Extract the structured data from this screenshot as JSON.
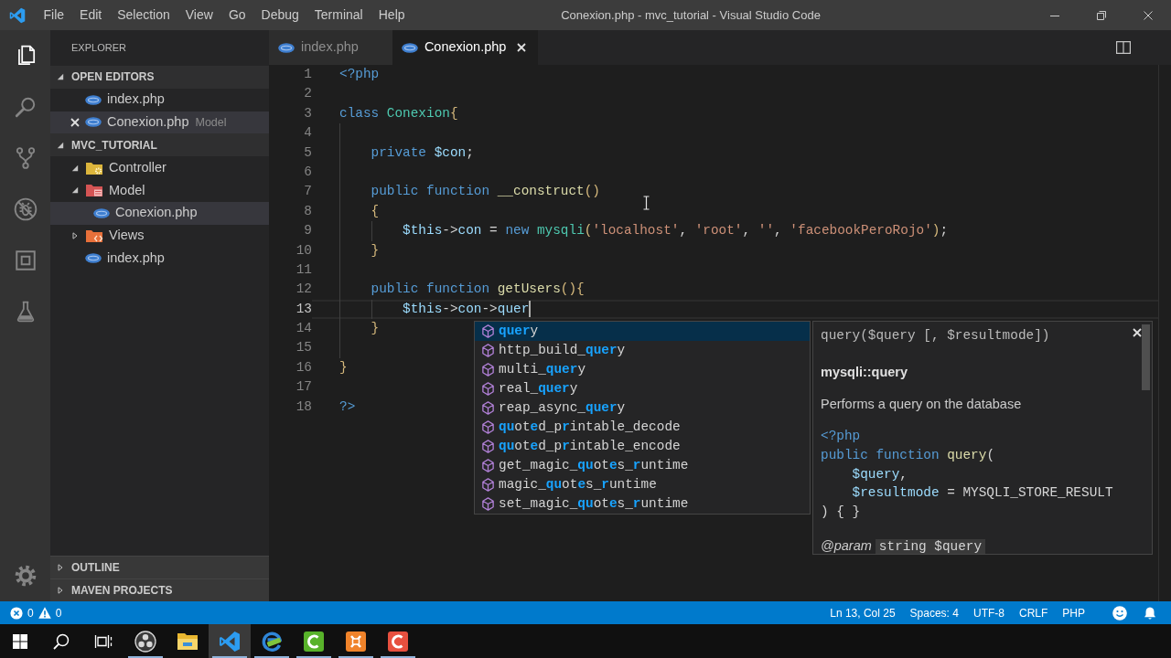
{
  "window": {
    "title": "Conexion.php - mvc_tutorial - Visual Studio Code"
  },
  "menu": [
    "File",
    "Edit",
    "Selection",
    "View",
    "Go",
    "Debug",
    "Terminal",
    "Help"
  ],
  "activity_bar": [
    {
      "kind": "explorer",
      "selected": true
    },
    {
      "kind": "search",
      "selected": false
    },
    {
      "kind": "source-control",
      "selected": false
    },
    {
      "kind": "debug",
      "selected": false
    },
    {
      "kind": "extensions",
      "selected": false
    },
    {
      "kind": "testing",
      "selected": false
    }
  ],
  "sidebar": {
    "title": "EXPLORER",
    "open_editors": {
      "title": "OPEN EDITORS",
      "expanded": true,
      "items": [
        {
          "name": "index.php",
          "selected": false
        },
        {
          "name": "Conexion.php",
          "description": "Model",
          "selected": true
        }
      ]
    },
    "folder": {
      "title": "MVC_TUTORIAL",
      "expanded": true,
      "children": [
        {
          "kind": "controller",
          "name": "Controller",
          "expanded": true,
          "selected": false
        },
        {
          "kind": "model",
          "name": "Model",
          "expanded": true,
          "selected": false,
          "children": [
            {
              "kind": "php",
              "name": "Conexion.php",
              "selected": true
            }
          ]
        },
        {
          "kind": "views",
          "name": "Views",
          "expanded": false,
          "selected": false
        },
        {
          "kind": "php",
          "name": "index.php",
          "selected": false
        }
      ]
    },
    "panels": [
      {
        "title": "OUTLINE",
        "expanded": false
      },
      {
        "title": "MAVEN PROJECTS",
        "expanded": false
      }
    ]
  },
  "editor": {
    "tabs": [
      {
        "label": "index.php",
        "selected": false
      },
      {
        "label": "Conexion.php",
        "selected": true
      }
    ],
    "lines": [
      {
        "number": "1",
        "current": false,
        "tokens": [
          {
            "kind": "keyword",
            "text": "<?php"
          }
        ]
      },
      {
        "number": "2",
        "current": false
      },
      {
        "number": "3",
        "current": false,
        "tokens": [
          {
            "kind": "keyword",
            "text": "class"
          },
          {
            "kind": "type",
            "text": " Conexion"
          },
          {
            "kind": "bracket",
            "text": "{"
          }
        ]
      },
      {
        "number": "4",
        "current": false
      },
      {
        "number": "5",
        "current": false,
        "tokens": [
          {
            "kind": "keyword",
            "text": "    private"
          },
          {
            "kind": "variable",
            "text": " $con"
          },
          {
            "kind": "plain",
            "text": ";"
          }
        ]
      },
      {
        "number": "6",
        "current": false
      },
      {
        "number": "7",
        "current": false,
        "tokens": [
          {
            "kind": "keyword",
            "text": "    public function"
          },
          {
            "kind": "function",
            "text": " __construct"
          },
          {
            "kind": "bracket",
            "text": "()"
          }
        ]
      },
      {
        "number": "8",
        "current": false,
        "tokens": [
          {
            "kind": "bracket",
            "text": "    {"
          }
        ]
      },
      {
        "number": "9",
        "current": false,
        "tokens": [
          {
            "kind": "variable",
            "text": "        $this"
          },
          {
            "kind": "plain",
            "text": "->"
          },
          {
            "kind": "variable",
            "text": "con"
          },
          {
            "kind": "plain",
            "text": " = "
          },
          {
            "kind": "keyword",
            "text": "new"
          },
          {
            "kind": "type",
            "text": " mysqli"
          },
          {
            "kind": "bracket",
            "text": "("
          },
          {
            "kind": "string",
            "text": "'localhost'"
          },
          {
            "kind": "plain",
            "text": ", "
          },
          {
            "kind": "string",
            "text": "'root'"
          },
          {
            "kind": "plain",
            "text": ", "
          },
          {
            "kind": "string",
            "text": "''"
          },
          {
            "kind": "plain",
            "text": ", "
          },
          {
            "kind": "string",
            "text": "'facebookPeroRojo'"
          },
          {
            "kind": "bracket",
            "text": ")"
          },
          {
            "kind": "plain",
            "text": ";"
          }
        ]
      },
      {
        "number": "10",
        "current": false,
        "tokens": [
          {
            "kind": "bracket",
            "text": "    }"
          }
        ]
      },
      {
        "number": "11",
        "current": false
      },
      {
        "number": "12",
        "current": false,
        "tokens": [
          {
            "kind": "keyword",
            "text": "    public function"
          },
          {
            "kind": "function",
            "text": " getUsers"
          },
          {
            "kind": "bracket",
            "text": "(){"
          }
        ]
      },
      {
        "number": "13",
        "current": true,
        "tokens": [
          {
            "kind": "variable",
            "text": "        $this"
          },
          {
            "kind": "plain",
            "text": "->"
          },
          {
            "kind": "variable",
            "text": "con"
          },
          {
            "kind": "plain",
            "text": "->"
          },
          {
            "kind": "variable",
            "text": "quer"
          }
        ]
      },
      {
        "number": "14",
        "current": false,
        "tokens": [
          {
            "kind": "bracket",
            "text": "    }"
          }
        ]
      },
      {
        "number": "15",
        "current": false
      },
      {
        "number": "16",
        "current": false,
        "tokens": [
          {
            "kind": "bracket",
            "text": "}"
          }
        ]
      },
      {
        "number": "17",
        "current": false
      },
      {
        "number": "18",
        "current": false,
        "tokens": [
          {
            "kind": "keyword",
            "text": "?>"
          }
        ]
      }
    ],
    "suggestions": [
      {
        "label": "**quer**y",
        "selected": true
      },
      {
        "label": "http_build_**quer**y",
        "selected": false
      },
      {
        "label": "multi_**quer**y",
        "selected": false
      },
      {
        "label": "real_**quer**y",
        "selected": false
      },
      {
        "label": "reap_async_**quer**y",
        "selected": false
      },
      {
        "label": "**qu**ot**e**d_p**r**intable_decode",
        "selected": false
      },
      {
        "label": "**qu**ot**e**d_p**r**intable_encode",
        "selected": false
      },
      {
        "label": "get_magic_**qu**ot**e**s_**r**untime",
        "selected": false
      },
      {
        "label": "magic_**qu**ot**e**s_**r**untime",
        "selected": false
      },
      {
        "label": "set_magic_**qu**ot**e**s_**r**untime",
        "selected": false
      }
    ],
    "details": {
      "signature": "query($query [, $resultmode])",
      "title": "mysqli::query",
      "description": "Performs a query on the database",
      "code": [
        {
          "tokens": [
            {
              "kind": "keyword",
              "text": "<?php"
            }
          ]
        },
        {
          "tokens": [
            {
              "kind": "keyword",
              "text": "public function"
            },
            {
              "kind": "function",
              "text": " query"
            },
            {
              "kind": "plain",
              "text": "("
            }
          ]
        },
        {
          "tokens": [
            {
              "kind": "variable",
              "text": "    $query"
            },
            {
              "kind": "plain",
              "text": ","
            }
          ]
        },
        {
          "tokens": [
            {
              "kind": "variable",
              "text": "    $resultmode"
            },
            {
              "kind": "plain",
              "text": " = MYSQLI_STORE_RESULT"
            }
          ]
        },
        {
          "tokens": [
            {
              "kind": "plain",
              "text": ") { }"
            }
          ]
        }
      ],
      "param_tag": "@param",
      "param_text": "string $query"
    }
  },
  "status_bar": {
    "errors": "0",
    "warnings": "0",
    "items": [
      "Ln 13, Col 25",
      "Spaces: 4",
      "UTF-8",
      "CRLF",
      "PHP"
    ]
  },
  "taskbar": [
    {
      "kind": "obs",
      "running": true,
      "selected": false
    },
    {
      "kind": "explorer",
      "running": false,
      "selected": false
    },
    {
      "kind": "vscode",
      "running": true,
      "selected": true
    },
    {
      "kind": "edge-dev",
      "running": true,
      "selected": false
    },
    {
      "kind": "camtasia",
      "running": true,
      "selected": false
    },
    {
      "kind": "xampp",
      "running": true,
      "selected": false
    },
    {
      "kind": "camtasia-recorder",
      "running": true,
      "selected": false
    }
  ]
}
